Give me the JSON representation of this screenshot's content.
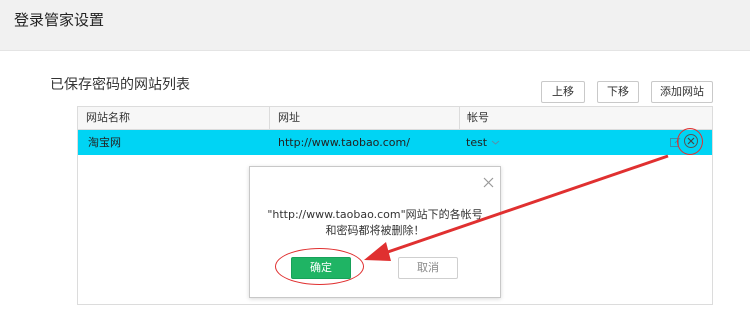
{
  "header": {
    "title": "登录管家设置"
  },
  "section": {
    "title": "已保存密码的网站列表"
  },
  "toolbar": {
    "up_label": "上移",
    "down_label": "下移",
    "add_label": "添加网站"
  },
  "table": {
    "columns": [
      "网站名称",
      "网址",
      "帐号"
    ],
    "rows": [
      {
        "name": "淘宝网",
        "url": "http://www.taobao.com/",
        "account": "test"
      }
    ]
  },
  "dialog": {
    "message": "\"http://www.taobao.com\"网站下的各帐号和密码都将被删除！",
    "confirm_label": "确定",
    "cancel_label": "取消"
  },
  "colors": {
    "selected_row": "#00d4f4",
    "confirm_button": "#1fb464",
    "annotation": "#e03030"
  }
}
